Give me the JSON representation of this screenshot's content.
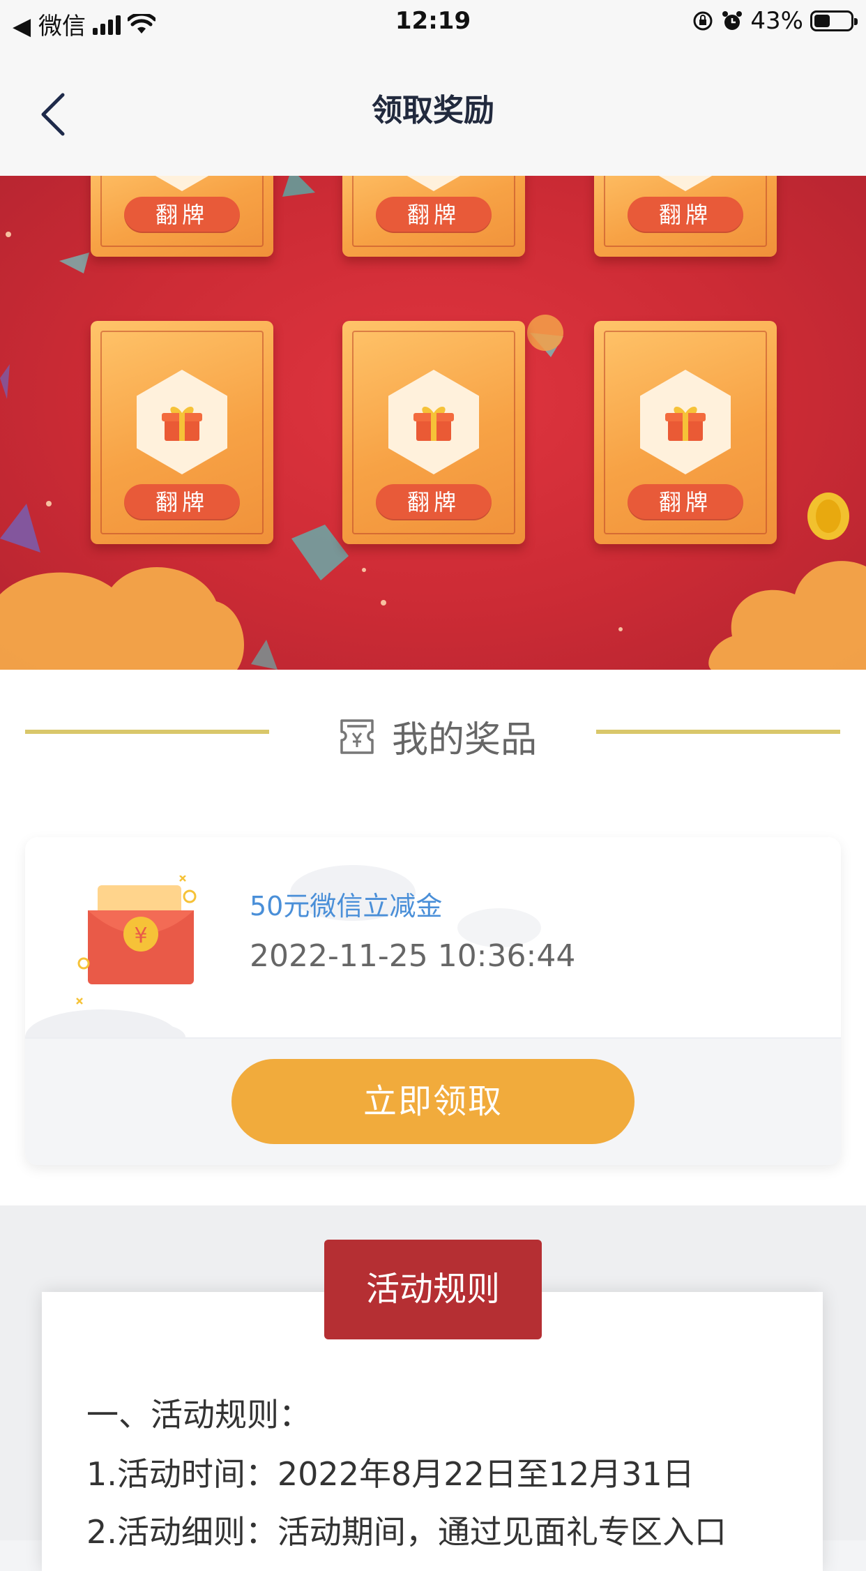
{
  "status_bar": {
    "carrier": "◀ 微信",
    "time": "12:19",
    "battery_text": "43%",
    "battery_level": 0.43
  },
  "nav": {
    "title": "领取奖励",
    "back_icon": "chevron-left-icon"
  },
  "banner": {
    "cards": [
      {
        "label": "翻牌"
      },
      {
        "label": "翻牌"
      },
      {
        "label": "翻牌"
      },
      {
        "label": "翻牌"
      },
      {
        "label": "翻牌"
      },
      {
        "label": "翻牌"
      }
    ]
  },
  "prizes": {
    "section_title": "我的奖品",
    "section_icon": "voucher-icon",
    "item": {
      "name": "50元微信立减金",
      "time": "2022-11-25 10:36:44",
      "icon": "red-envelope-icon",
      "claim_label": "立即领取"
    }
  },
  "rules": {
    "tab_label": "活动规则",
    "lines": [
      "一、活动规则：",
      "1.活动时间：2022年8月22日至12月31日",
      "2.活动细则：活动期间，通过见面礼专区入口"
    ]
  },
  "colors": {
    "banner_red": "#cc2b35",
    "card_orange": "#f7a245",
    "flip_button": "#e85a39",
    "claim_button": "#f1ab3c",
    "rules_tab": "#b52f33",
    "prize_name_blue": "#4a8fd8",
    "gold_line": "#d9c76a"
  }
}
